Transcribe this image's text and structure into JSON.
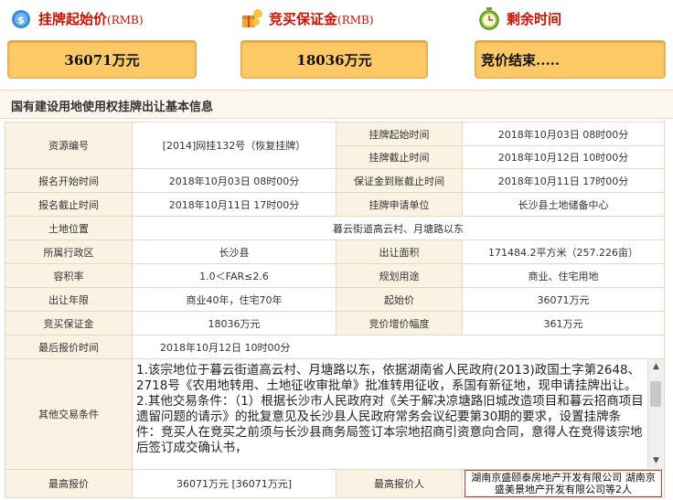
{
  "header": {
    "start_price_title": "挂牌起始价",
    "start_price_unit": "(RMB)",
    "deposit_title": "竞买保证金",
    "deposit_unit": "(RMB)",
    "remaining_title": "剩余时间",
    "start_price_value": "36071万元",
    "deposit_value": "18036万元",
    "remaining_value": "竞价结束....."
  },
  "section_title": "国有建设用地使用权挂牌出让基本信息",
  "rows": {
    "resource_no_label": "资源编号",
    "resource_no_value": "[2014]网挂132号（恢复挂牌）",
    "listing_start_label": "挂牌起始时间",
    "listing_start_value": "2018年10月03日 08时00分",
    "listing_end_label": "挂牌截止时间",
    "listing_end_value": "2018年10月12日 10时00分",
    "reg_start_label": "报名开始时间",
    "reg_start_value": "2018年10月03日 08时00分",
    "deposit_deadline_label": "保证金到账截止时间",
    "deposit_deadline_value": "2018年10月11日 17时00分",
    "reg_end_label": "报名截止时间",
    "reg_end_value": "2018年10月11日 17时00分",
    "applicant_label": "挂牌申请单位",
    "applicant_value": "长沙县土地储备中心",
    "location_label": "土地位置",
    "location_value": "暮云街道高云村、月塘路以东",
    "district_label": "所属行政区",
    "district_value": "长沙县",
    "area_label": "出让面积",
    "area_value": "171484.2平方米（257.226亩）",
    "far_label": "容积率",
    "far_value": "1.0＜FAR≤2.6",
    "use_label": "规划用途",
    "use_value": "商业、住宅用地",
    "term_label": "出让年限",
    "term_value": "商业40年，住宅70年",
    "start_price_label": "起始价",
    "start_price_value": "36071万元",
    "bid_deposit_label": "竞买保证金",
    "bid_deposit_value": "18036万元",
    "increment_label": "竞价增价幅度",
    "increment_value": "361万元",
    "last_bid_time_label": "最后报价时间",
    "last_bid_time_value": "2018年10月12日 10时00分",
    "other_conditions_label": "其他交易条件",
    "other_conditions_text": "1.该宗地位于暮云街道高云村、月塘路以东，依据湖南省人民政府(2013)政国土字第2648、2718号《农用地转用、土地征收审批单》批准转用征收，系国有新征地，现申请挂牌出让。\n2.其他交易条件：（1）根据长沙市人民政府对《关于解决凉塘路旧城改造项目和暮云招商项目遗留问题的请示》的批复意见及长沙县人民政府常务会议纪要第30期的要求，设置挂牌条件：竞买人在竞买之前须与长沙县商务局签订本宗地招商引资意向合同，意得人在竞得该宗地后签订成交确认书，",
    "highest_bid_label": "最高报价",
    "highest_bid_value": "36071万元 [36071万元]",
    "highest_bidder_label": "最高报价人",
    "highest_bidder_value": "湖南京盛颐泰房地产开发有限公司 湖南京盛美景地产开发有限公司等2人"
  },
  "icons": {
    "start_price": "money-bag-icon",
    "deposit": "gift-coins-icon",
    "remaining": "stopwatch-icon"
  }
}
